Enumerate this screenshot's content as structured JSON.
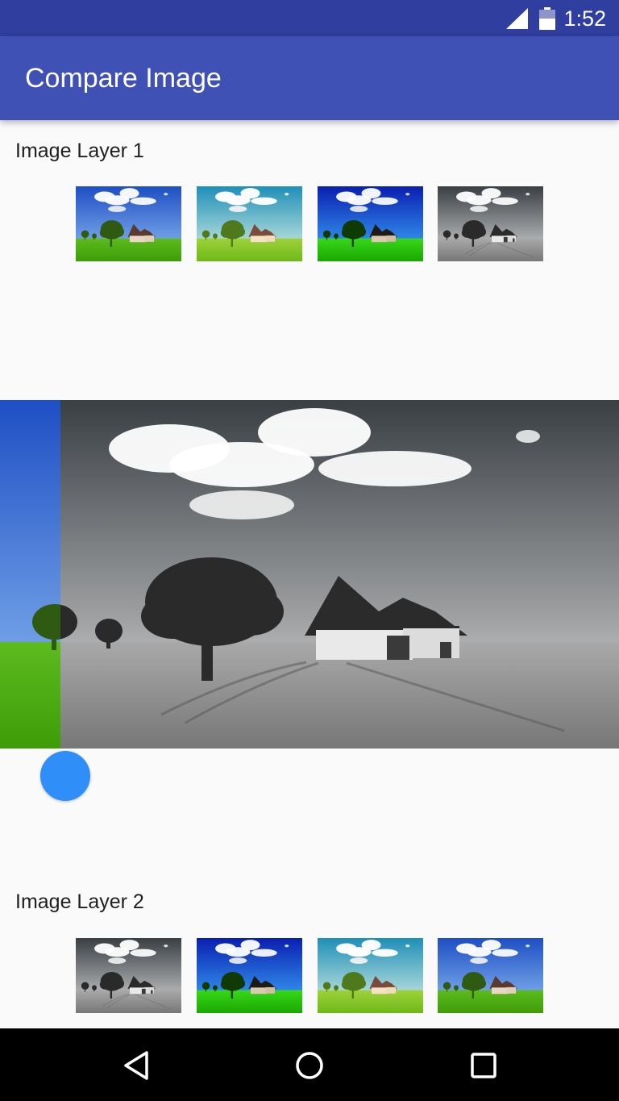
{
  "status_bar": {
    "time": "1:52",
    "icons": [
      "cell-signal-icon",
      "battery-icon"
    ]
  },
  "app_bar": {
    "title": "Compare Image"
  },
  "layer1": {
    "label": "Image Layer 1",
    "thumbnails": [
      {
        "filter": "original"
      },
      {
        "filter": "warm-light"
      },
      {
        "filter": "vivid"
      },
      {
        "filter": "grayscale"
      }
    ]
  },
  "layer2": {
    "label": "Image Layer 2",
    "thumbnails": [
      {
        "filter": "grayscale"
      },
      {
        "filter": "vivid"
      },
      {
        "filter": "warm-light"
      },
      {
        "filter": "original"
      }
    ]
  },
  "comparison": {
    "bottom_layer_filter": "original",
    "top_layer_filter": "grayscale",
    "divider_position": 0.098
  },
  "nav_bar": {
    "icons": [
      "back-icon",
      "home-icon",
      "recents-icon"
    ]
  },
  "colors": {
    "status_bar": "#303f9f",
    "app_bar": "#3f51b5",
    "slider_thumb": "#2f8ef8",
    "background": "#fafafa"
  }
}
